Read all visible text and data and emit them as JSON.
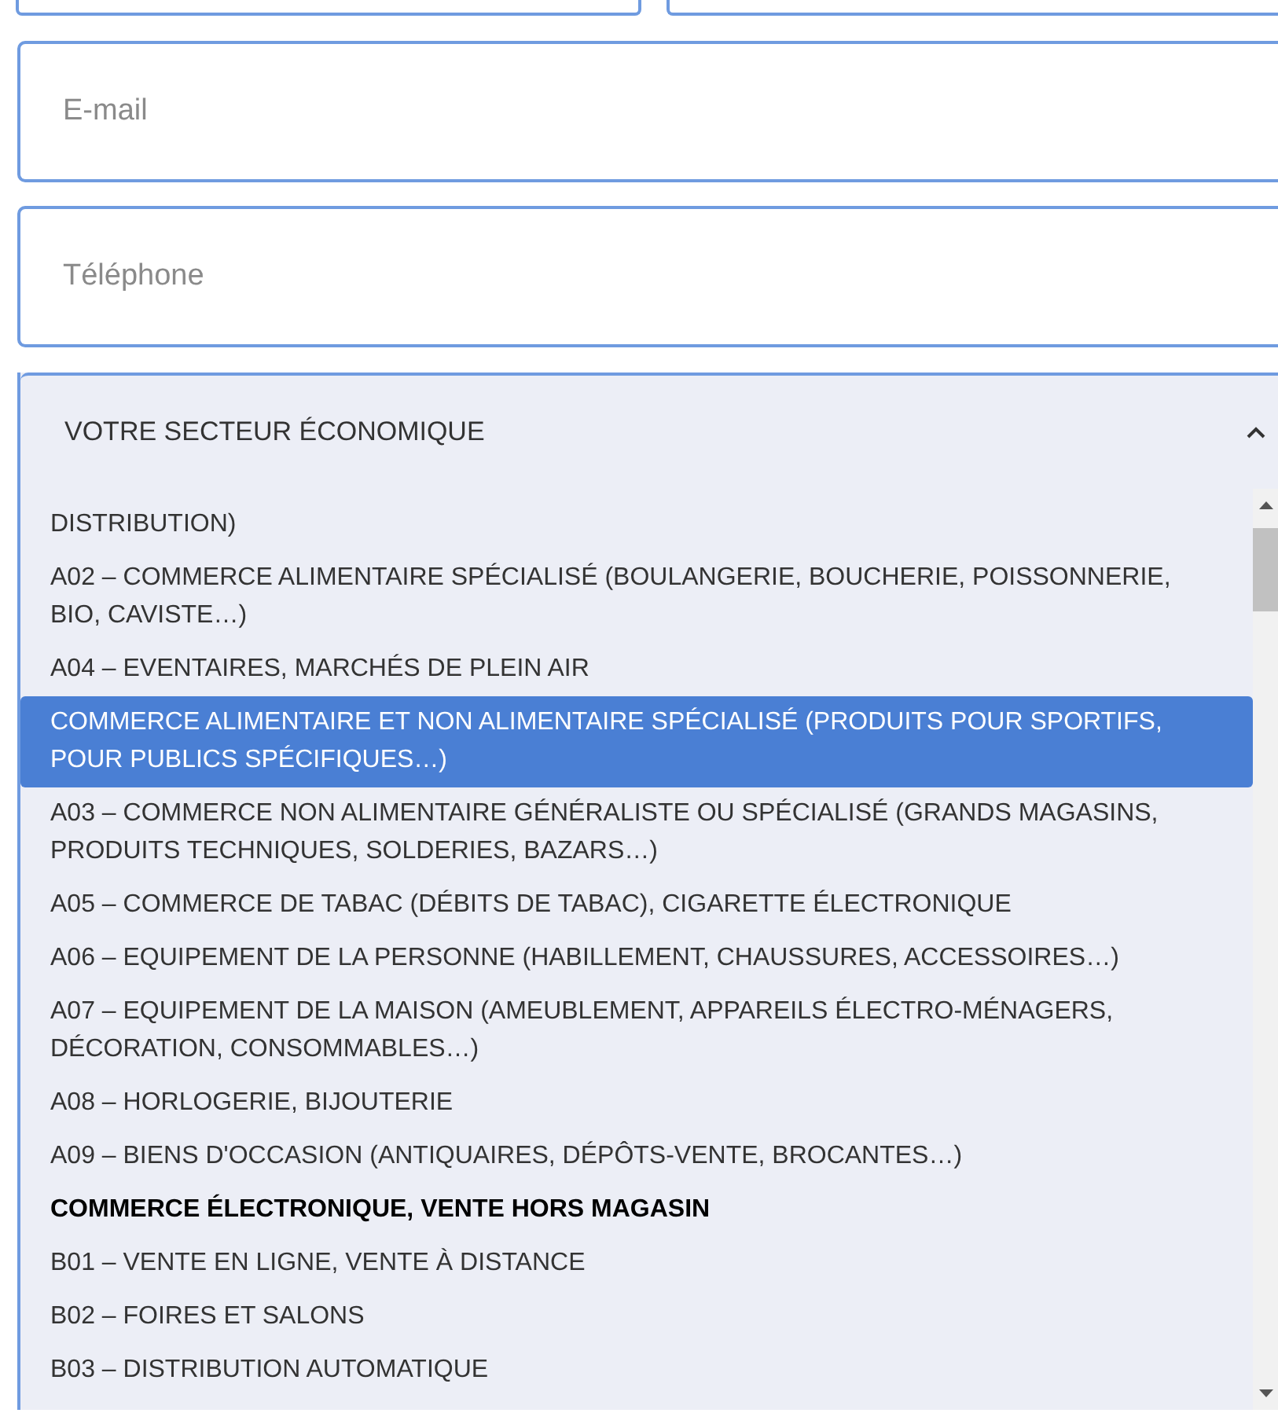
{
  "fields": [
    {
      "placeholder": "E-mail"
    },
    {
      "placeholder": "Téléphone"
    }
  ],
  "select": {
    "label": "VOTRE SECTEUR ÉCONOMIQUE",
    "expanded": true,
    "options": [
      {
        "kind": "option",
        "text": "DISTRIBUTION)",
        "selected": false
      },
      {
        "kind": "option",
        "text": "A02 – COMMERCE ALIMENTAIRE SPÉCIALISÉ (BOULANGERIE, BOUCHERIE, POISSONNERIE, BIO, CAVISTE…)",
        "selected": false
      },
      {
        "kind": "option",
        "text": "A04 – EVENTAIRES, MARCHÉS DE PLEIN AIR",
        "selected": false
      },
      {
        "kind": "option",
        "text": "COMMERCE ALIMENTAIRE ET NON ALIMENTAIRE SPÉCIALISÉ (PRODUITS POUR SPORTIFS, POUR PUBLICS SPÉCIFIQUES…)",
        "selected": true
      },
      {
        "kind": "option",
        "text": "A03 – COMMERCE NON ALIMENTAIRE GÉNÉRALISTE OU SPÉCIALISÉ (GRANDS MAGASINS, PRODUITS TECHNIQUES, SOLDERIES, BAZARS…)",
        "selected": false
      },
      {
        "kind": "option",
        "text": "A05 – COMMERCE DE TABAC (DÉBITS DE TABAC), CIGARETTE ÉLECTRONIQUE",
        "selected": false
      },
      {
        "kind": "option",
        "text": "A06 – EQUIPEMENT DE LA PERSONNE (HABILLEMENT, CHAUSSURES, ACCESSOIRES…)",
        "selected": false
      },
      {
        "kind": "option",
        "text": "A07 – EQUIPEMENT DE LA MAISON (AMEUBLEMENT, APPAREILS ÉLECTRO-MÉNAGERS, DÉCORATION, CONSOMMABLES…)",
        "selected": false
      },
      {
        "kind": "option",
        "text": "A08 – HORLOGERIE, BIJOUTERIE",
        "selected": false
      },
      {
        "kind": "option",
        "text": "A09 – BIENS D'OCCASION (ANTIQUAIRES, DÉPÔTS-VENTE, BROCANTES…)",
        "selected": false
      },
      {
        "kind": "group",
        "text": "COMMERCE ÉLECTRONIQUE, VENTE HORS MAGASIN",
        "selected": false
      },
      {
        "kind": "option",
        "text": "B01 – VENTE EN LIGNE, VENTE À DISTANCE",
        "selected": false
      },
      {
        "kind": "option",
        "text": "B02 – FOIRES ET SALONS",
        "selected": false
      },
      {
        "kind": "option",
        "text": "B03 – DISTRIBUTION AUTOMATIQUE",
        "selected": false
      }
    ]
  }
}
